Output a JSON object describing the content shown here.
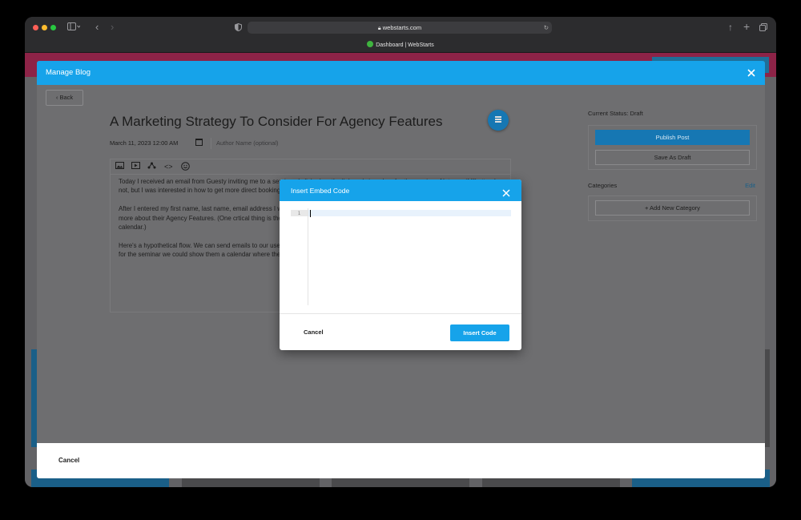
{
  "browser": {
    "url": "webstarts.com",
    "tab_title": "Dashboard | WebStarts"
  },
  "manage_blog": {
    "title": "Manage Blog",
    "back_label": "Back",
    "post_title": "A Marketing Strategy To Consider For Agency Features",
    "post_date": "March 11, 2023 12:00 AM",
    "author_placeholder": "Author Name (optional)",
    "body_paragraphs": [
      "Today I received an email from Guesty inviting me to a seminar. I clicked on the link and signed up for the seminar. Not sure if I'll attend or not, but I was interested in how to get more direct bookings.",
      "After I entered my first name, last name, email address I was taken to a page where I could book a time slot for someone to show me more about their Agency Features. (One crtical thing is they asked what region I was in, if I chose another region I wouldn't be shown the calendar.)",
      "Here's a hypothetical flow. We can send emails to our users inviting them to learn how to get more web design clients. When they sign up for the seminar we could show them a calendar where they could talk to someone about agency features and..."
    ],
    "status_label": "Current Status: Draft",
    "publish_label": "Publish Post",
    "save_draft_label": "Save As Draft",
    "categories_label": "Categories",
    "categories_edit": "Edit",
    "add_category_label": "Add New Category",
    "footer_cancel": "Cancel"
  },
  "embed_dialog": {
    "title": "Insert Embed Code",
    "line_number": "1",
    "cancel_label": "Cancel",
    "insert_label": "Insert Code"
  },
  "colors": {
    "accent": "#16a3ea",
    "publish": "#1677b3"
  }
}
